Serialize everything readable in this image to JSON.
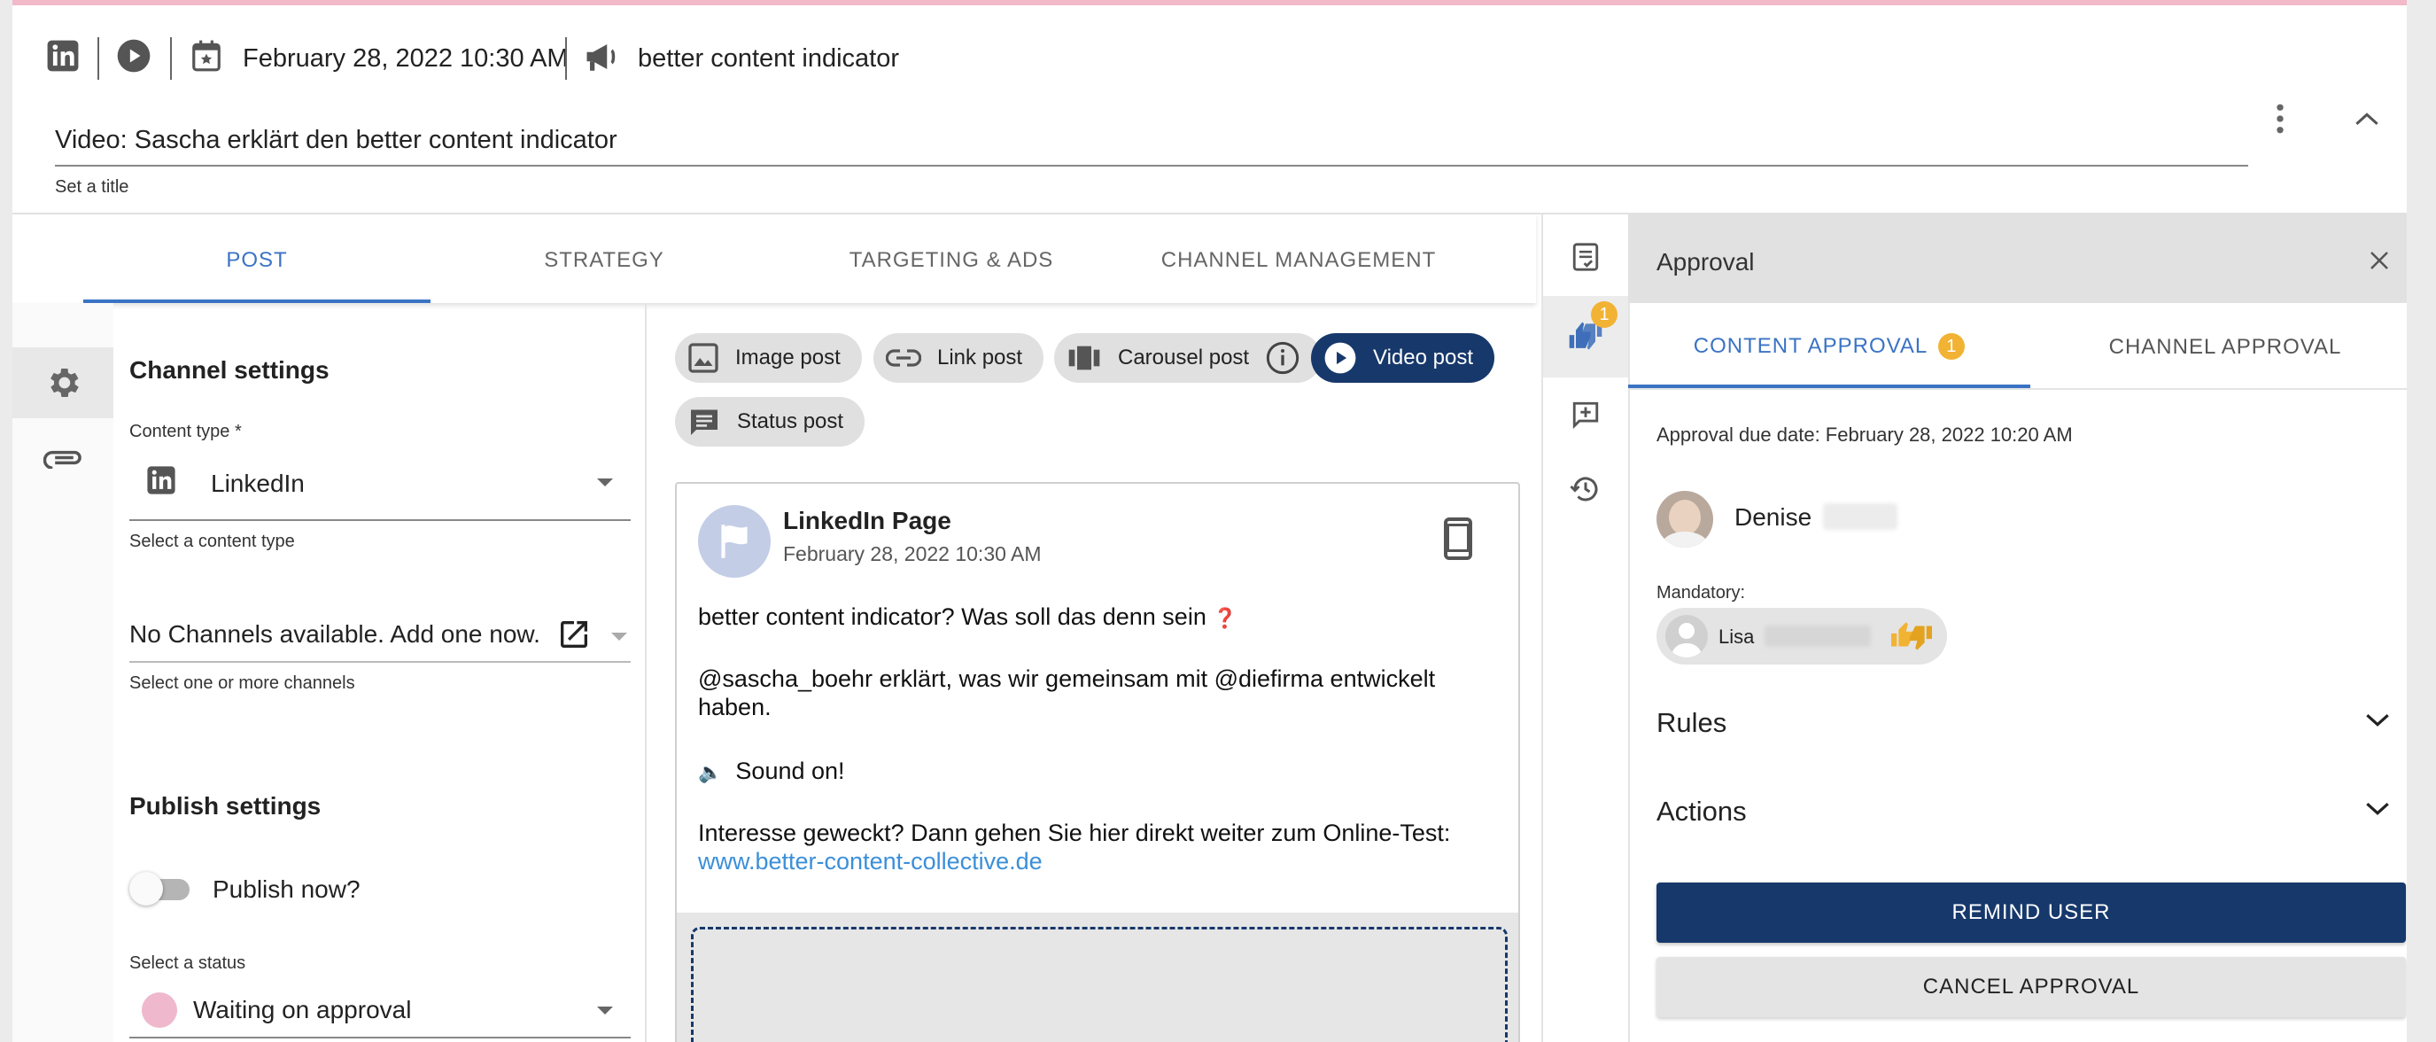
{
  "header": {
    "date": "February 28, 2022 10:30 AM",
    "campaign": "better content indicator",
    "title_value": "Video: Sascha erklärt den better content indicator",
    "title_hint": "Set a title"
  },
  "tabs": [
    {
      "label": "POST",
      "active": true
    },
    {
      "label": "STRATEGY",
      "active": false
    },
    {
      "label": "TARGETING & ADS",
      "active": false
    },
    {
      "label": "CHANNEL MANAGEMENT",
      "active": false
    }
  ],
  "settings": {
    "channel_settings_title": "Channel settings",
    "content_type_label": "Content type *",
    "content_type_value": "LinkedIn",
    "content_type_hint": "Select a content type",
    "channels_value": "No Channels available. Add one now.",
    "channels_hint": "Select one or more channels",
    "publish_settings_title": "Publish settings",
    "publish_now_label": "Publish now?",
    "status_label": "Select a status",
    "status_value": "Waiting on approval",
    "status_color": "#f0b8cc"
  },
  "post_types": [
    {
      "label": "Image post",
      "icon": "image-icon"
    },
    {
      "label": "Link post",
      "icon": "link-icon"
    },
    {
      "label": "Carousel post",
      "icon": "carousel-icon"
    },
    {
      "label": "Video post",
      "icon": "play-icon",
      "active": true
    },
    {
      "label": "Status post",
      "icon": "comment-icon"
    }
  ],
  "preview": {
    "page_name": "LinkedIn Page",
    "date": "February 28, 2022 10:30 AM",
    "line1": "better content indicator? Was soll das denn sein",
    "line1_emoji": "❓",
    "line2": "@sascha_boehr erklärt, was wir gemeinsam mit @diefirma entwickelt haben.",
    "line3_emoji": "🔈",
    "line3": "Sound on!",
    "line4": "Interesse geweckt? Dann gehen Sie hier direkt weiter zum Online-Test:",
    "link": "www.better-content-collective.de"
  },
  "side_badge": "1",
  "approval": {
    "title": "Approval",
    "tab_content": "CONTENT APPROVAL",
    "tab_content_badge": "1",
    "tab_channel": "CHANNEL APPROVAL",
    "due_date": "Approval due date: February 28, 2022 10:20 AM",
    "approver_name": "Denise",
    "mandatory_label": "Mandatory:",
    "mandatory_user": "Lisa",
    "rules_label": "Rules",
    "actions_label": "Actions",
    "remind_button": "REMIND USER",
    "cancel_button": "CANCEL APPROVAL"
  },
  "colors": {
    "accent": "#17386b",
    "tab_active": "#3b73c4",
    "badge": "#f2b233",
    "link": "#3b8fd8",
    "top_border": "#f2b9c9"
  }
}
